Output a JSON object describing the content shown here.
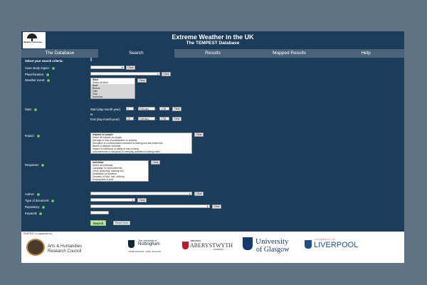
{
  "header": {
    "logo_text": "Weather Extremes",
    "title": "Extreme Weather in the UK",
    "subtitle": "The TEMPEST Database"
  },
  "nav": {
    "tabs": [
      "The Database",
      "Search",
      "Results",
      "Mapped Results",
      "Help"
    ],
    "active": "Search"
  },
  "form": {
    "heading": "Select your search criteria:",
    "labels": {
      "region": "Case study region:",
      "place": "Place/location:",
      "event": "Weather event:",
      "date": "Date:",
      "impact": "Impact:",
      "response": "Response:",
      "author": "Author:",
      "doctype": "Type of document:",
      "repository": "Repository:",
      "keyword": "Keyword:"
    },
    "clear_label": "Clear",
    "weather_list": [
      "Wind",
      "Select all Wind",
      "Blast",
      "Breeze",
      "Gale",
      "Gust",
      "Hurricane"
    ],
    "date": {
      "start_label": "Start (day-month-year)",
      "to_label": "to",
      "end_label": "End (day-month-year)",
      "start_day": "1",
      "start_month": "February",
      "start_year": "1798",
      "end_day": "28",
      "end_month": "February",
      "end_year": "1798"
    },
    "impact_list": [
      "Impacts on people",
      "Select all impacts on people",
      "Damage or loss of possessions or property",
      "Disruption to communication networks including post and telephone",
      "Illness or disease outbreak",
      "Impact on livelihood or ability to earn a living",
      "Inconvenience or disruption to everyday activities including travel"
    ],
    "response_list": [
      "Individual",
      "Select all Individual",
      "Campaign for improvements",
      "Crime (poaching, stealing etc)",
      "Distribution of food/fuel",
      "Donation of food, fuel, clothing",
      "Employment of poor"
    ],
    "search_label": "Search",
    "reset_label": "Reset form"
  },
  "footer": {
    "supported_by": "TEMPEST is supported by",
    "ahrc": [
      "Arts & Humanities",
      "Research Council"
    ],
    "nottingham": [
      "The University of",
      "Nottingham",
      "UNITED KINGDOM · CHINA · MALAYSIA"
    ],
    "aberystwyth": [
      "PRIFYSGOL",
      "ABERYSTWYTH",
      "UNIVERSITY"
    ],
    "glasgow": [
      "University",
      "of Glasgow"
    ],
    "liverpool": [
      "UNIVERSITY OF",
      "LIVERPOOL"
    ]
  },
  "colors": {
    "page_bg": "#5f7385",
    "panel_bg": "#1c3d5a",
    "nav_bg": "#4b6378",
    "help_icon": "#58b34f"
  }
}
